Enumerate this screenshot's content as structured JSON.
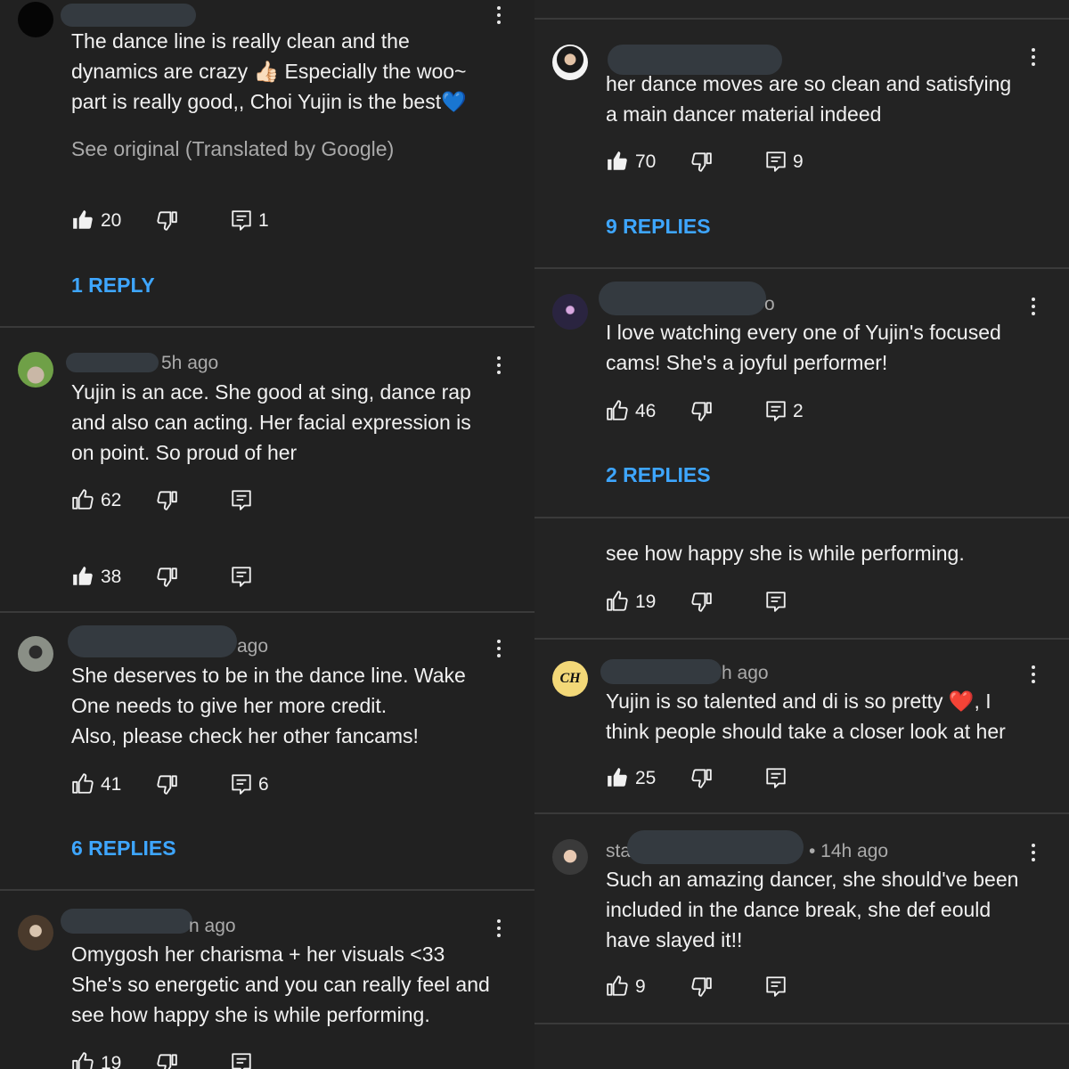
{
  "left": {
    "c1": {
      "lines": [
        "The dance line is really clean and the",
        "dynamics are crazy 👍🏻 Especially the woo~",
        "part is really good,, Choi Yujin is the best💙"
      ],
      "translate": "See original (Translated by Google)",
      "likes": "20",
      "replies_count": "1",
      "replies_link": "1 REPLY"
    },
    "c2": {
      "time": "5h ago",
      "lines": [
        "Yujin is an ace. She good at sing, dance rap",
        "and also can acting. Her facial expression is",
        "on point. So proud of her"
      ],
      "likes": "62"
    },
    "c2b": {
      "likes": "38"
    },
    "c3": {
      "time": "ago",
      "lines": [
        "She deserves to be in the dance line. Wake",
        "One needs to give her more credit.",
        "Also, please check her other fancams!"
      ],
      "likes": "41",
      "replies_count": "6",
      "replies_link": "6 REPLIES"
    },
    "c4": {
      "time": "n ago",
      "lines": [
        "Omygosh her charisma + her visuals <33",
        "She's so energetic and you can really feel and",
        "see how happy she is while performing."
      ],
      "likes": "19"
    }
  },
  "right": {
    "c1": {
      "lines": [
        "her dance moves are so clean and satisfying",
        "a main dancer material indeed"
      ],
      "likes": "70",
      "replies_count": "9",
      "replies_link": "9 REPLIES"
    },
    "c2": {
      "time": "o",
      "lines": [
        "I love watching every one of Yujin's focused",
        "cams! She's a joyful performer!"
      ],
      "likes": "46",
      "replies_count": "2",
      "replies_link": "2 REPLIES"
    },
    "c3": {
      "lines": [
        "see how happy she is while performing."
      ],
      "likes": "19"
    },
    "c4": {
      "avatar_text": "CH",
      "time": "h ago",
      "lines": [
        "Yujin is so talented and di is so pretty ❤️, I",
        "think people should take a closer look at her"
      ],
      "likes": "25"
    },
    "c5": {
      "name_prefix": "sta",
      "time": "• 14h ago",
      "lines": [
        "Such an amazing dancer, she should've been",
        "included in the dance break, she def eould",
        "have slayed it!!"
      ],
      "likes": "9"
    }
  },
  "colors": {
    "background": "#212121",
    "text": "#f1f1f1",
    "meta": "#aaaaaa",
    "link": "#3ea6ff",
    "redaction": "#343a40"
  },
  "icons": [
    "thumbs-up-icon",
    "thumbs-down-icon",
    "reply-icon",
    "more-options-icon"
  ]
}
